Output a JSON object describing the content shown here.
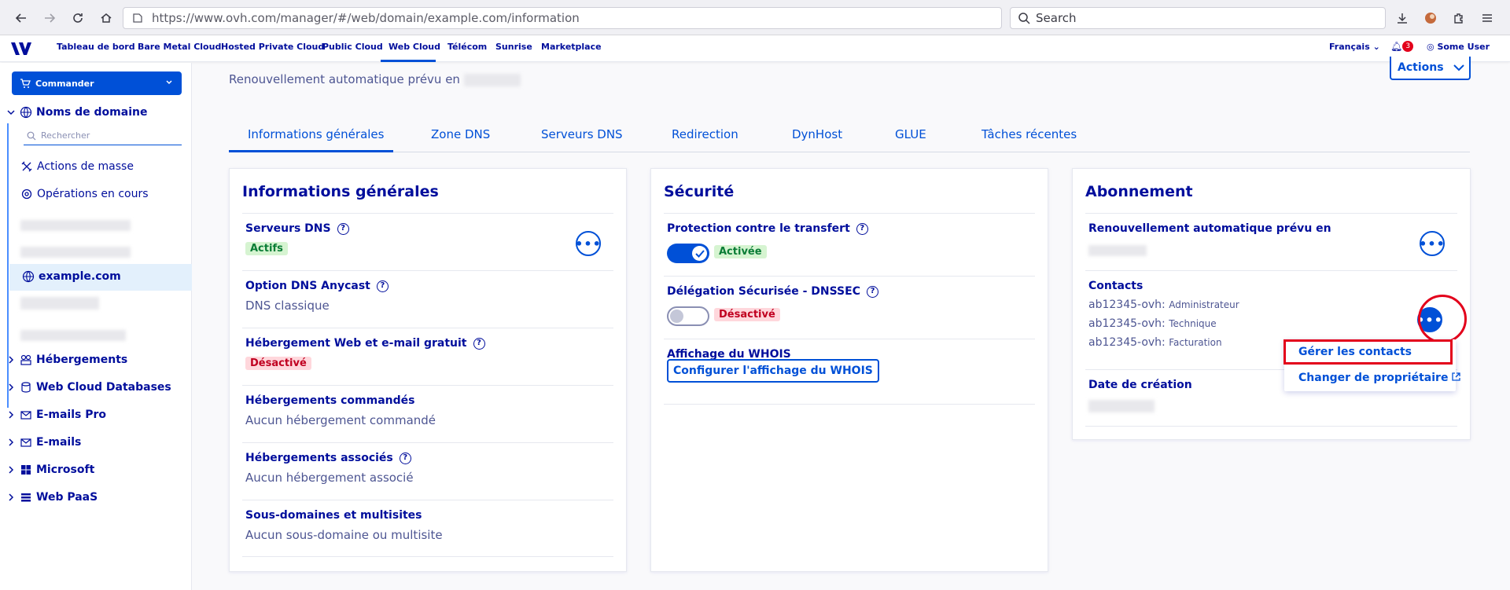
{
  "browser": {
    "url": "https://www.ovh.com/manager/#/web/domain/example.com/information",
    "search_placeholder": "Search"
  },
  "top_nav": {
    "links": [
      "Tableau de bord",
      "Bare Metal Cloud",
      "Hosted Private Cloud",
      "Public Cloud",
      "Web Cloud",
      "Télécom",
      "Sunrise",
      "Marketplace"
    ],
    "active": "Web Cloud",
    "language": "Français",
    "notification_count": "3",
    "user": "Some User"
  },
  "sidebar": {
    "commander_label": "Commander",
    "domains_label": "Noms de domaine",
    "search_placeholder": "Rechercher",
    "mass_actions": "Actions de masse",
    "ongoing_ops": "Opérations en cours",
    "selected_domain": "example.com",
    "sections": [
      "Hébergements",
      "Web Cloud Databases",
      "E-mails Pro",
      "E-mails",
      "Microsoft",
      "Web PaaS"
    ]
  },
  "header": {
    "renewal_text": "Renouvellement automatique prévu en",
    "actions_label": "Actions"
  },
  "tabs": [
    "Informations générales",
    "Zone DNS",
    "Serveurs DNS",
    "Redirection",
    "DynHost",
    "GLUE",
    "Tâches récentes"
  ],
  "general_card": {
    "title": "Informations générales",
    "dns_servers_label": "Serveurs DNS",
    "dns_servers_status": "Actifs",
    "anycast_label": "Option DNS Anycast",
    "anycast_value": "DNS classique",
    "hosting_free_label": "Hébergement Web et e-mail gratuit",
    "hosting_free_status": "Désactivé",
    "hosting_ordered_label": "Hébergements commandés",
    "hosting_ordered_value": "Aucun hébergement commandé",
    "hosting_assoc_label": "Hébergements associés",
    "hosting_assoc_value": "Aucun hébergement associé",
    "subdomains_label": "Sous-domaines et multisites",
    "subdomains_value": "Aucun sous-domaine ou multisite"
  },
  "security_card": {
    "title": "Sécurité",
    "transfer_label": "Protection contre le transfert",
    "transfer_status": "Activée",
    "dnssec_label": "Délégation Sécurisée - DNSSEC",
    "dnssec_status": "Désactivé",
    "whois_label": "Affichage du WHOIS",
    "whois_button": "Configurer l'affichage du WHOIS"
  },
  "subscription_card": {
    "title": "Abonnement",
    "renewal_label": "Renouvellement automatique prévu en",
    "contacts_label": "Contacts",
    "contacts": [
      {
        "id": "ab12345-ovh:",
        "role": "Administrateur"
      },
      {
        "id": "ab12345-ovh:",
        "role": "Technique"
      },
      {
        "id": "ab12345-ovh:",
        "role": "Facturation"
      }
    ],
    "creation_label": "Date de création"
  },
  "contacts_menu": {
    "manage_contacts": "Gérer les contacts",
    "change_owner": "Changer de propriétaire"
  },
  "colors": {
    "primary": "#0050d7",
    "navy": "#000e9c",
    "highlight": "#e3001b"
  }
}
